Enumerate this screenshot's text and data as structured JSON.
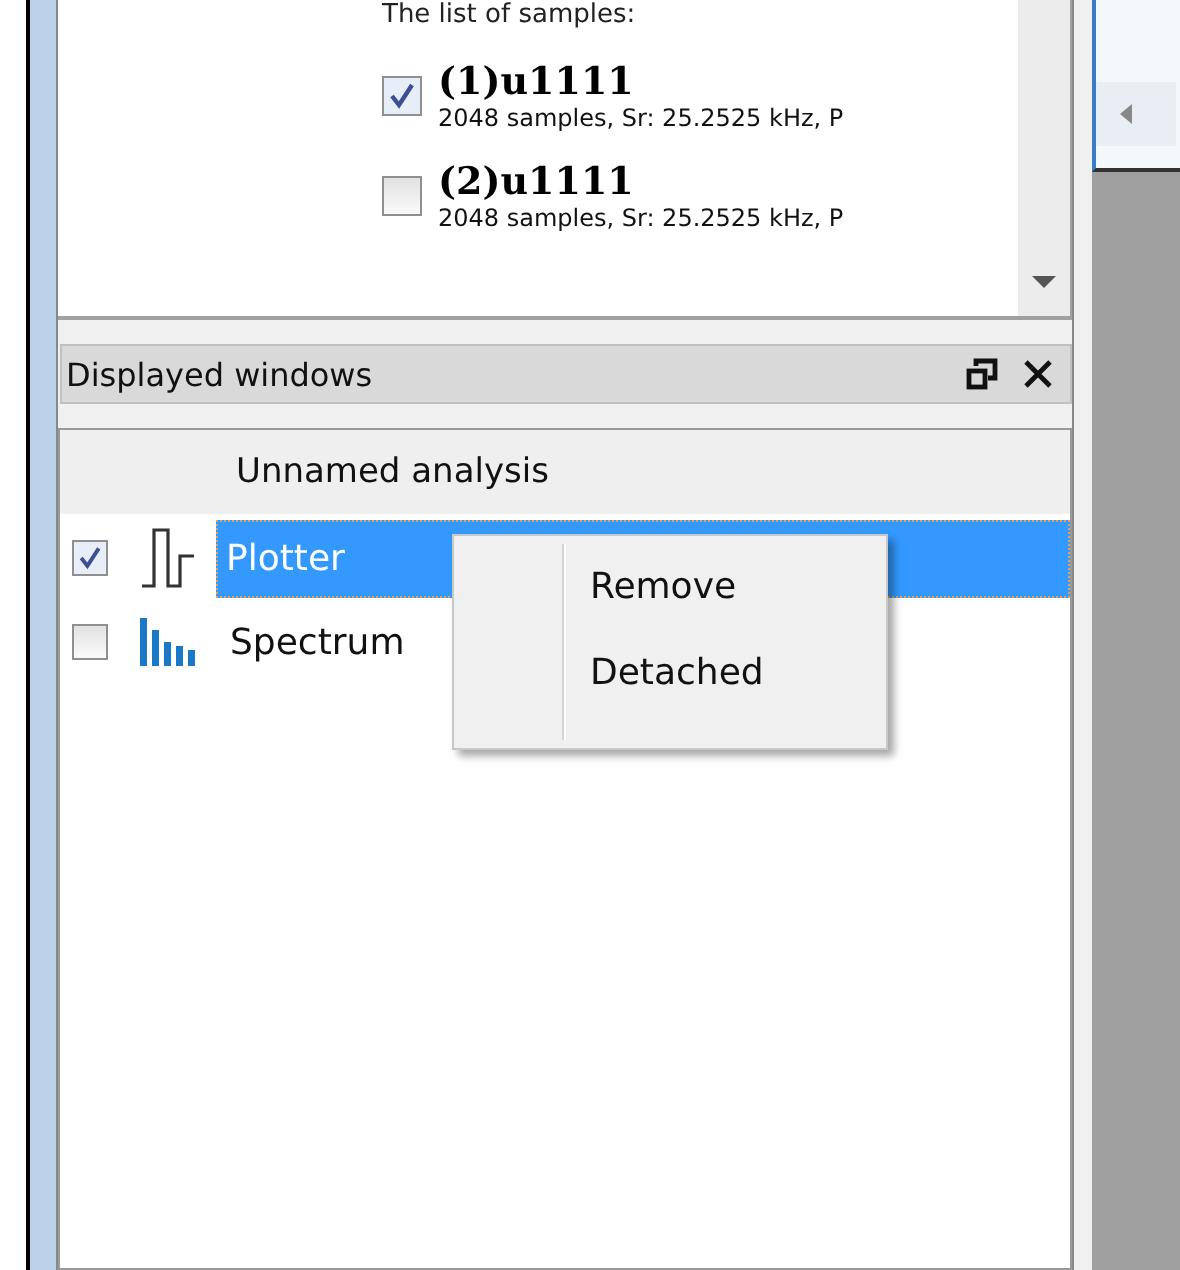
{
  "samples": {
    "caption": "The list of samples:",
    "items": [
      {
        "title": "(1)u1111",
        "detail": "2048 samples, Sr: 25.2525 kHz, P",
        "checked": true
      },
      {
        "title": "(2)u1111",
        "detail": "2048 samples, Sr: 25.2525 kHz, P",
        "checked": false
      }
    ]
  },
  "panel": {
    "title": "Displayed windows"
  },
  "tree": {
    "root": "Unnamed analysis",
    "children": [
      {
        "label": "Plotter",
        "kind": "plotter",
        "checked": true,
        "selected": true
      },
      {
        "label": "Spectrum",
        "kind": "spectrum",
        "checked": false,
        "selected": false
      }
    ]
  },
  "context_menu": {
    "items": [
      "Remove",
      "Detached"
    ]
  }
}
